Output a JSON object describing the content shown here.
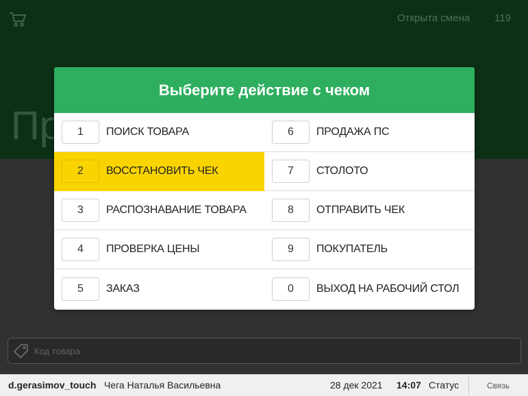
{
  "app": {
    "shift_status": "Открыта смена",
    "shift_number": "119",
    "big_title": "Продажа",
    "search_placeholder": "Код товара"
  },
  "modal": {
    "title": "Выберите действие с чеком",
    "left_items": [
      {
        "key": "1",
        "label": "ПОИСК ТОВАРА",
        "active": false
      },
      {
        "key": "2",
        "label": "ВОССТАНОВИТЬ ЧЕК",
        "active": true
      },
      {
        "key": "3",
        "label": "РАСПОЗНАВАНИЕ ТОВАРА",
        "active": false
      },
      {
        "key": "4",
        "label": "ПРОВЕРКА ЦЕНЫ",
        "active": false
      },
      {
        "key": "5",
        "label": "ЗАКАЗ",
        "active": false
      }
    ],
    "right_items": [
      {
        "key": "6",
        "label": "ПРОДАЖА ПС",
        "active": false
      },
      {
        "key": "7",
        "label": "СТОЛОТО",
        "active": false
      },
      {
        "key": "8",
        "label": "ОТПРАВИТЬ ЧЕК",
        "active": false
      },
      {
        "key": "9",
        "label": "ПОКУПАТЕЛЬ",
        "active": false
      },
      {
        "key": "0",
        "label": "ВЫХОД НА РАБОЧИЙ СТОЛ",
        "active": false
      }
    ]
  },
  "statusbar": {
    "login": "d.gerasimov_touch",
    "cashier": "Чега Наталья Васильевна",
    "date": "28 дек 2021",
    "time": "14:07",
    "status_label": "Статус",
    "link_label": "Связь"
  },
  "colors": {
    "header_green": "#2eae5f",
    "active_yellow": "#fad400",
    "app_header": "#0f3b1b"
  },
  "icons": [
    "cart-icon",
    "tag-icon"
  ]
}
